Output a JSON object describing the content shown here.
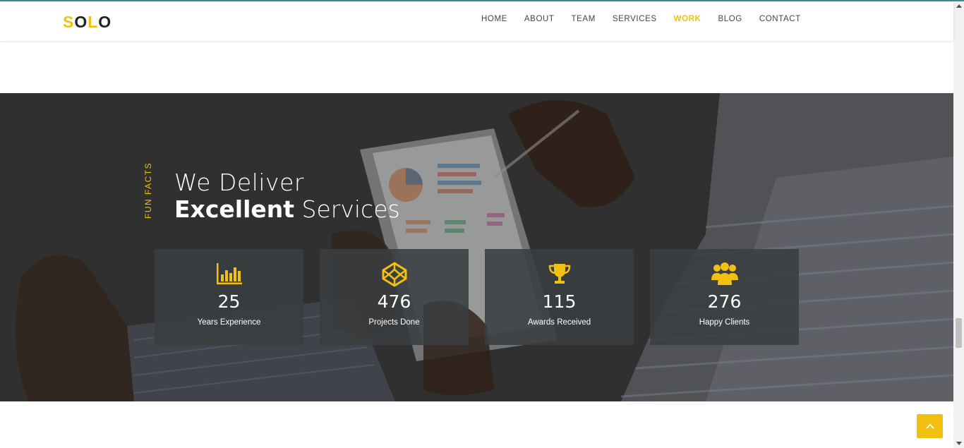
{
  "header": {
    "logo": {
      "first": "S",
      "middle": "O",
      "yellow_letter": "L",
      "last": "O"
    },
    "nav": [
      {
        "label": "HOME",
        "active": false
      },
      {
        "label": "ABOUT",
        "active": false
      },
      {
        "label": "TEAM",
        "active": false
      },
      {
        "label": "SERVICES",
        "active": false
      },
      {
        "label": "WORK",
        "active": true
      },
      {
        "label": "BLOG",
        "active": false
      },
      {
        "label": "CONTACT",
        "active": false
      }
    ]
  },
  "facts": {
    "side_label": "FUN FACTS",
    "heading_line1": "We Deliver",
    "heading_bold": "Excellent",
    "heading_light": "Services",
    "stats": [
      {
        "icon": "bar-chart-icon",
        "value": "25",
        "label": "Years Experience"
      },
      {
        "icon": "codepen-icon",
        "value": "476",
        "label": "Projects Done"
      },
      {
        "icon": "trophy-icon",
        "value": "115",
        "label": "Awards Received"
      },
      {
        "icon": "users-icon",
        "value": "276",
        "label": "Happy Clients"
      }
    ]
  },
  "colors": {
    "accent": "#f2c10f",
    "dark_bg": "#3a3a3a",
    "card_bg": "#3a3e40"
  }
}
